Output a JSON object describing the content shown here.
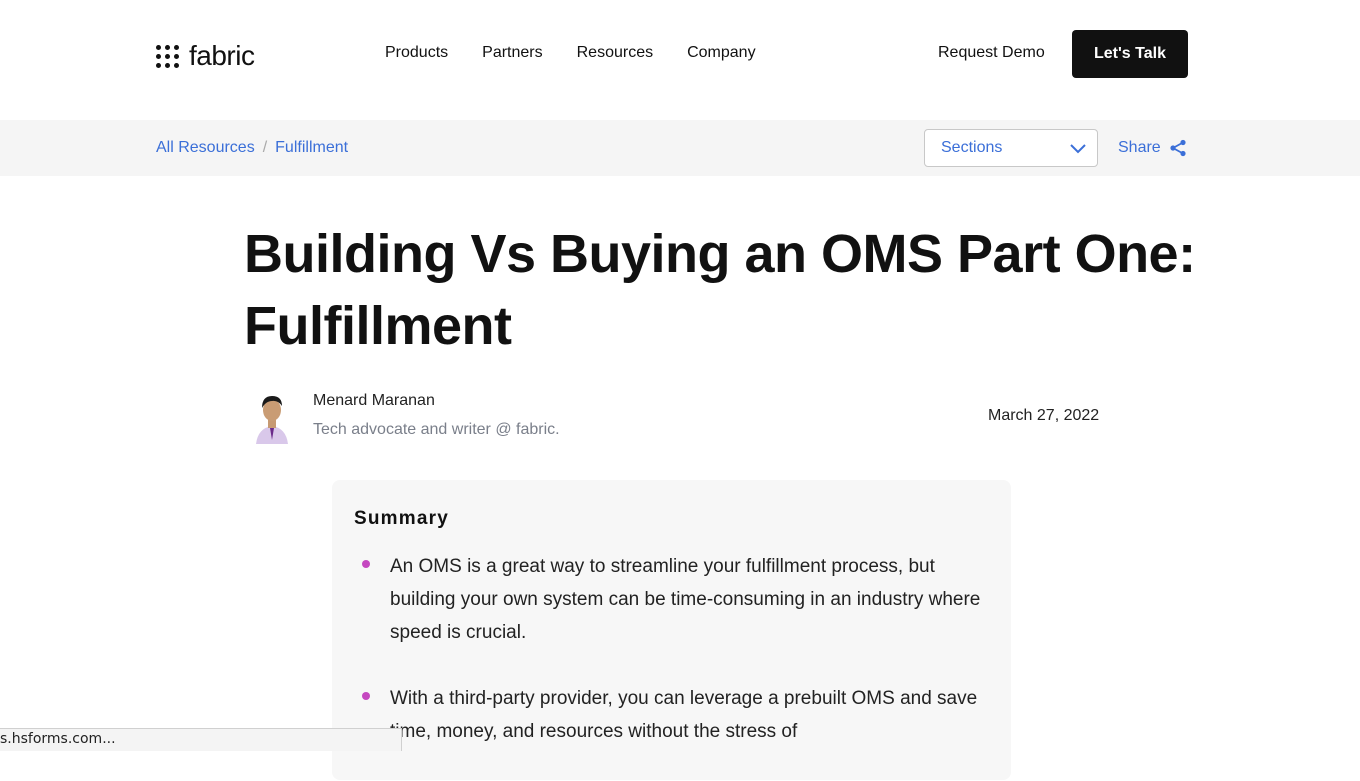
{
  "header": {
    "logo_text": "fabric",
    "nav": [
      "Products",
      "Partners",
      "Resources",
      "Company"
    ],
    "request_demo": "Request Demo",
    "cta": "Let's Talk"
  },
  "breadcrumb": {
    "items": [
      "All Resources",
      "Fulfillment"
    ],
    "separator": "/"
  },
  "sections_dropdown": {
    "label": "Sections"
  },
  "share": {
    "label": "Share"
  },
  "article": {
    "title": "Building Vs Buying an OMS Part One: Fulfillment",
    "author": {
      "name": "Menard Maranan",
      "bio": "Tech advocate and writer @ fabric."
    },
    "date": "March 27, 2022"
  },
  "summary": {
    "title": "Summary",
    "bullets": [
      "An OMS is a great way to streamline your fulfillment process, but building your own system can be time-consuming in an industry where speed is crucial.",
      "With a third-party provider, you can leverage a prebuilt OMS and save time, money, and resources without the stress of"
    ]
  },
  "status_bar": {
    "url": "s.hsforms.com..."
  },
  "colors": {
    "link": "#3b6fd8",
    "bullet": "#c548c0",
    "cta_bg": "#111111"
  },
  "icons": [
    "fabric-logo-icon",
    "chevron-down-icon",
    "share-icon"
  ]
}
